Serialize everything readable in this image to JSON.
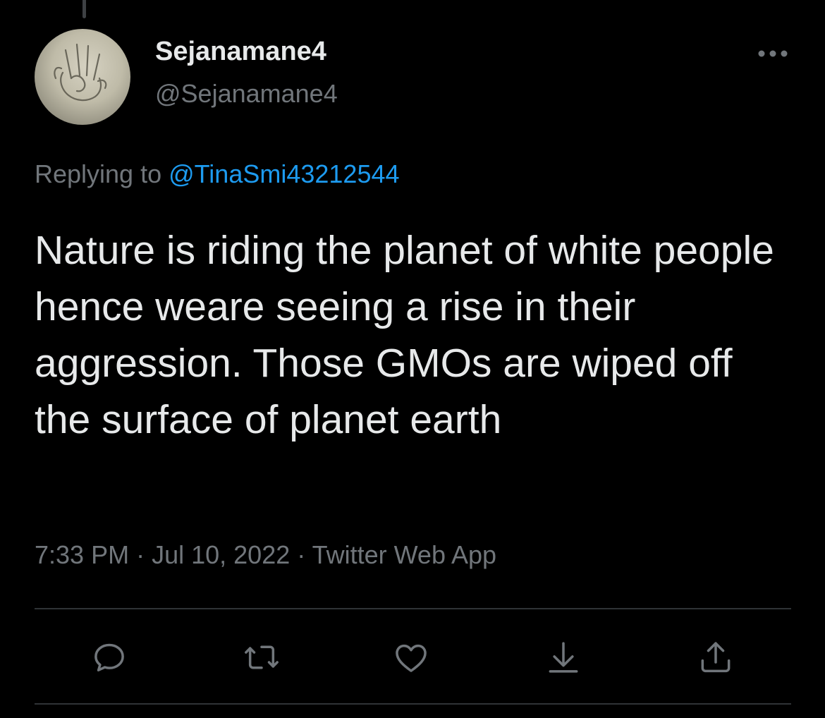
{
  "author": {
    "display_name": "Sejanamane4",
    "handle": "@Sejanamane4",
    "avatar_icon": "hand-drawing-avatar"
  },
  "reply": {
    "prefix": "Replying to ",
    "mention": "@TinaSmi43212544"
  },
  "tweet": {
    "text": "Nature is riding the planet of white people hence weare seeing a rise in their aggression. Those GMOs are wiped off the surface of planet earth"
  },
  "meta": {
    "time": "7:33 PM",
    "separator1": " · ",
    "date": "Jul 10, 2022",
    "separator2": " · ",
    "source": "Twitter Web App"
  },
  "actions": [
    {
      "icon": "reply-icon"
    },
    {
      "icon": "retweet-icon"
    },
    {
      "icon": "heart-icon"
    },
    {
      "icon": "bookmark-download-icon"
    },
    {
      "icon": "share-icon"
    }
  ],
  "colors": {
    "background": "#000000",
    "text": "#e7e9ea",
    "secondary": "#71767b",
    "accent": "#1d9bf0",
    "divider": "#2f3336"
  }
}
